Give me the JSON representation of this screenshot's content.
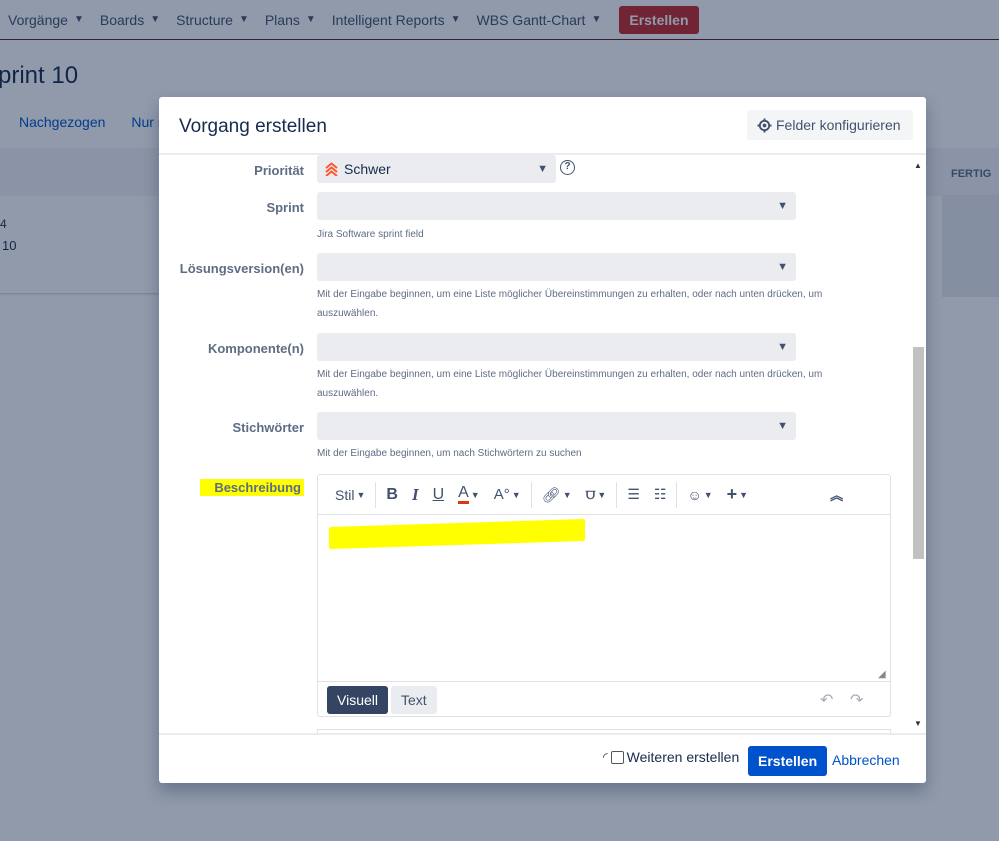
{
  "topnav": {
    "items": [
      "Vorgänge",
      "Boards",
      "Structure",
      "Plans",
      "Intelligent Reports",
      "WBS Gantt-Chart"
    ],
    "create_label": "Erstellen"
  },
  "page": {
    "title": "print 10",
    "links": [
      "Nachgezogen",
      "Nur m"
    ],
    "column_fertig": "FERTIG",
    "card_line1": "4",
    "card_line2": "10"
  },
  "modal": {
    "title": "Vorgang erstellen",
    "config_label": "Felder konfigurieren",
    "fields": {
      "priority": {
        "label": "Priorität",
        "value": "Schwer"
      },
      "sprint": {
        "label": "Sprint",
        "value": "",
        "help": "Jira Software sprint field"
      },
      "fix_version": {
        "label": "Lösungsversion(en)",
        "value": "",
        "help": "Mit der Eingabe beginnen, um eine Liste möglicher Übereinstimmungen zu erhalten, oder nach unten drücken, um auszuwählen."
      },
      "component": {
        "label": "Komponente(n)",
        "value": "",
        "help": "Mit der Eingabe beginnen, um eine Liste möglicher Übereinstimmungen zu erhalten, oder nach unten drücken, um auszuwählen."
      },
      "labels": {
        "label": "Stichwörter",
        "value": "",
        "help": "Mit der Eingabe beginnen, um nach Stichwörtern zu suchen"
      },
      "description": {
        "label": "Beschreibung"
      }
    },
    "editor": {
      "style_label": "Stil",
      "mode_visual": "Visuell",
      "mode_text": "Text"
    },
    "footer": {
      "create_another": "Weiteren erstellen",
      "create_another_checked": false,
      "create_label": "Erstellen",
      "cancel_label": "Abbrechen"
    }
  },
  "colors": {
    "primary": "#0052cc",
    "nav_create": "#c62828",
    "highlight": "#ffff00",
    "priority_icon": "#ff5630"
  }
}
